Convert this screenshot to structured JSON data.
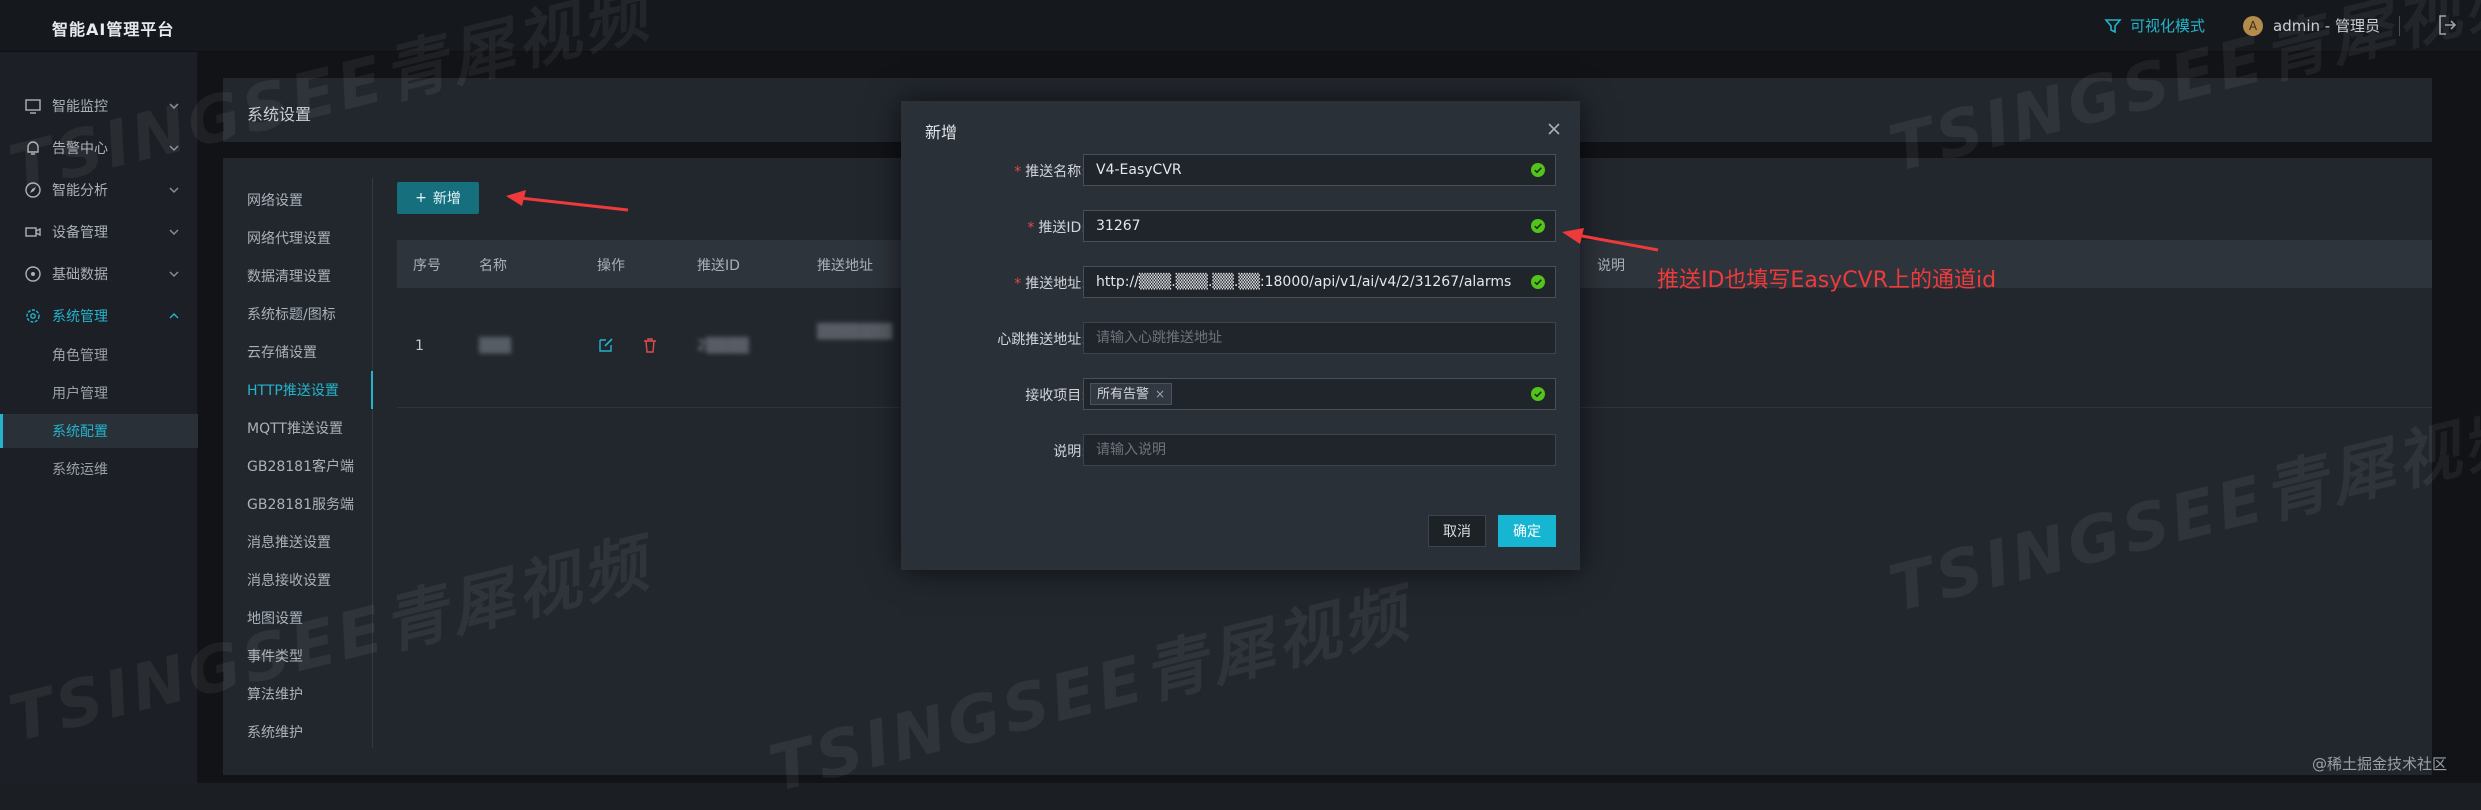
{
  "app": {
    "title": "智能AI管理平台"
  },
  "topbar": {
    "viz_mode": "可视化模式",
    "user": "admin - 管理员",
    "avatar_letter": "A"
  },
  "sidebar": {
    "items": [
      {
        "label": "智能监控",
        "icon": "monitor-icon"
      },
      {
        "label": "告警中心",
        "icon": "bell-icon"
      },
      {
        "label": "智能分析",
        "icon": "compass-icon"
      },
      {
        "label": "设备管理",
        "icon": "camera-icon"
      },
      {
        "label": "基础数据",
        "icon": "disc-icon"
      },
      {
        "label": "系统管理",
        "icon": "gear-icon"
      }
    ],
    "sub_items": [
      "角色管理",
      "用户管理",
      "系统配置",
      "系统运维"
    ],
    "active_sub": "系统配置"
  },
  "page": {
    "title": "系统设置"
  },
  "settings_menu": {
    "items": [
      "网络设置",
      "网络代理设置",
      "数据清理设置",
      "系统标题/图标",
      "云存储设置",
      "HTTP推送设置",
      "MQTT推送设置",
      "GB28181客户端",
      "GB28181服务端",
      "消息推送设置",
      "消息接收设置",
      "地图设置",
      "事件类型",
      "算法维护",
      "系统维护"
    ],
    "active": "HTTP推送设置"
  },
  "toolbar": {
    "add_label": "新增"
  },
  "table": {
    "headers": [
      "序号",
      "名称",
      "操作",
      "推送ID",
      "推送地址",
      "说明"
    ],
    "rows": [
      {
        "index": "1",
        "name": "▒▒▒",
        "push_id": "2▒▒▒▒",
        "push_addr": "▒▒▒▒▒▒▒"
      }
    ]
  },
  "dialog": {
    "title": "新增",
    "fields": {
      "name": {
        "label": "推送名称:",
        "value": "V4-EasyCVR",
        "required": true
      },
      "push_id": {
        "label": "推送ID:",
        "value": "31267",
        "required": true
      },
      "push_addr": {
        "label": "推送地址:",
        "value": "http://▒▒▒.▒▒▒.▒▒.▒▒:18000/api/v1/ai/v4/2/31267/alarms",
        "required": true
      },
      "heartbeat": {
        "label": "心跳推送地址:",
        "placeholder": "请输入心跳推送地址"
      },
      "receive": {
        "label": "接收项目:",
        "tag": "所有告警"
      },
      "description": {
        "label": "说明:",
        "placeholder": "请输入说明"
      }
    },
    "cancel_label": "取消",
    "ok_label": "确定"
  },
  "annotation": {
    "text": "推送ID也填写EasyCVR上的通道id"
  },
  "watermark": {
    "text": "TSINGSEE青犀视频"
  },
  "credit": {
    "text": "@稀土掘金技术社区"
  },
  "colors": {
    "accent": "#23b4cc",
    "annotation": "#ee3a3a",
    "valid": "#52c41a"
  }
}
